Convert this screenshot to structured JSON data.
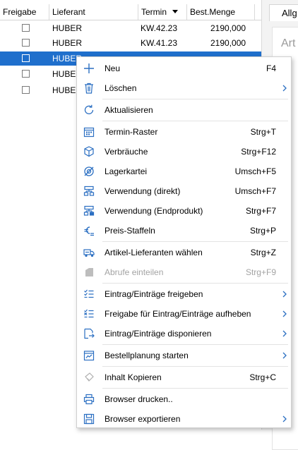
{
  "grid": {
    "columns": [
      "Freigabe",
      "Lieferant",
      "Termin",
      "Best.Menge"
    ],
    "rows": [
      {
        "lieferant": "HUBER",
        "termin": "KW.42.23",
        "menge": "2190,000"
      },
      {
        "lieferant": "HUBER",
        "termin": "KW.41.23",
        "menge": "2190,000"
      },
      {
        "lieferant": "HUBER",
        "termin": "",
        "menge": ""
      },
      {
        "lieferant": "HUBER",
        "termin": "",
        "menge": ""
      },
      {
        "lieferant": "HUBER",
        "termin": "",
        "menge": ""
      }
    ]
  },
  "right_panel": {
    "tab_label": "Allg",
    "box_label": "Art"
  },
  "menu": {
    "items": [
      {
        "label": "Neu",
        "shortcut": "F4",
        "icon": "plus-icon"
      },
      {
        "label": "Löschen",
        "shortcut": "",
        "icon": "trash-icon",
        "submenu": true
      },
      {
        "label": "Aktualisieren",
        "shortcut": "",
        "icon": "refresh-icon"
      },
      {
        "label": "Termin-Raster",
        "shortcut": "Strg+T",
        "icon": "calendar-grid-icon"
      },
      {
        "label": "Verbräuche",
        "shortcut": "Strg+F12",
        "icon": "cube-icon"
      },
      {
        "label": "Lagerkartei",
        "shortcut": "Umsch+F5",
        "icon": "ring-stock-icon"
      },
      {
        "label": "Verwendung (direkt)",
        "shortcut": "Umsch+F7",
        "icon": "tree-direct-icon"
      },
      {
        "label": "Verwendung (Endprodukt)",
        "shortcut": "Strg+F7",
        "icon": "tree-end-icon"
      },
      {
        "label": "Preis-Staffeln",
        "shortcut": "Strg+P",
        "icon": "euro-tiers-icon"
      },
      {
        "label": "Artikel-Lieferanten wählen",
        "shortcut": "Strg+Z",
        "icon": "delivery-truck-icon"
      },
      {
        "label": "Abrufe einteilen",
        "shortcut": "Strg+F9",
        "icon": "abrufe-icon",
        "disabled": true
      },
      {
        "label": "Eintrag/Einträge freigeben",
        "shortcut": "",
        "icon": "checklist-icon",
        "submenu": true
      },
      {
        "label": "Freigabe für Eintrag/Einträge aufheben",
        "shortcut": "",
        "icon": "checklist-cancel-icon",
        "submenu": true
      },
      {
        "label": "Eintrag/Einträge disponieren",
        "shortcut": "",
        "icon": "dispose-icon",
        "submenu": true
      },
      {
        "label": "Bestellplanung starten",
        "shortcut": "",
        "icon": "order-planning-icon",
        "submenu": true
      },
      {
        "label": "Inhalt Kopieren",
        "shortcut": "Strg+C",
        "icon": "copy-content-icon"
      },
      {
        "label": "Browser drucken..",
        "shortcut": "",
        "icon": "print-icon"
      },
      {
        "label": "Browser exportieren",
        "shortcut": "",
        "icon": "export-icon",
        "submenu": true
      }
    ]
  },
  "colors": {
    "selection": "#1f6fcc",
    "icon_blue": "#2b6fc2",
    "disabled": "#a3a3a3"
  }
}
